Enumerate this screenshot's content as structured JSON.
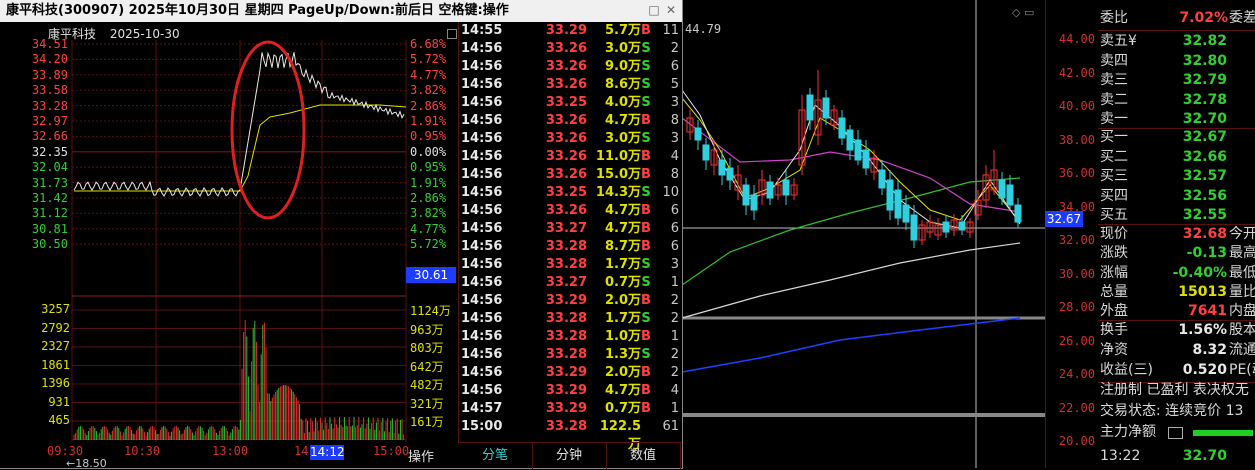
{
  "popup": {
    "title": "康平科技(300907) 2025年10月30日 星期四 PageUp/Down:前后日 空格键:操作",
    "chart_name": "康平科技",
    "chart_date": "2025-10-30",
    "left_axis": [
      "34.51",
      "34.20",
      "33.89",
      "33.58",
      "33.28",
      "32.97",
      "32.66",
      "32.35",
      "32.04",
      "31.73",
      "31.42",
      "31.12",
      "30.81",
      "30.50"
    ],
    "right_axis": [
      "6.68%",
      "5.72%",
      "4.77%",
      "3.82%",
      "2.86%",
      "1.91%",
      "0.95%",
      "0.00%",
      "0.95%",
      "1.91%",
      "2.86%",
      "3.82%",
      "4.77%",
      "5.72%"
    ],
    "vol_left_axis": [
      "3257",
      "2792",
      "2327",
      "1861",
      "1396",
      "931",
      "465"
    ],
    "vol_right_axis": [
      "1124万",
      "963万",
      "803万",
      "642万",
      "482万",
      "321万",
      "161万"
    ],
    "time_axis": [
      "09:30",
      "10:30",
      "13:00",
      "14",
      "15:00"
    ],
    "current_price_tag": "30.61",
    "current_time_tag": "14:12",
    "ops_label": "操作",
    "bottom_left_label": "←18.50"
  },
  "ticks": [
    {
      "time": "14:55",
      "price": "33.29",
      "vol": "5.7万",
      "dir": "B",
      "n": "11"
    },
    {
      "time": "14:56",
      "price": "33.26",
      "vol": "3.0万",
      "dir": "S",
      "n": "2"
    },
    {
      "time": "14:56",
      "price": "33.26",
      "vol": "9.0万",
      "dir": "S",
      "n": "6"
    },
    {
      "time": "14:56",
      "price": "33.26",
      "vol": "8.6万",
      "dir": "S",
      "n": "5"
    },
    {
      "time": "14:56",
      "price": "33.25",
      "vol": "4.0万",
      "dir": "S",
      "n": "3"
    },
    {
      "time": "14:56",
      "price": "33.26",
      "vol": "4.7万",
      "dir": "B",
      "n": "8"
    },
    {
      "time": "14:56",
      "price": "33.26",
      "vol": "3.0万",
      "dir": "S",
      "n": "3"
    },
    {
      "time": "14:56",
      "price": "33.26",
      "vol": "11.0万",
      "dir": "B",
      "n": "4"
    },
    {
      "time": "14:56",
      "price": "33.26",
      "vol": "15.0万",
      "dir": "B",
      "n": "8"
    },
    {
      "time": "14:56",
      "price": "33.25",
      "vol": "14.3万",
      "dir": "S",
      "n": "10"
    },
    {
      "time": "14:56",
      "price": "33.26",
      "vol": "4.7万",
      "dir": "B",
      "n": "6"
    },
    {
      "time": "14:56",
      "price": "33.27",
      "vol": "4.7万",
      "dir": "B",
      "n": "6"
    },
    {
      "time": "14:56",
      "price": "33.28",
      "vol": "8.7万",
      "dir": "B",
      "n": "6"
    },
    {
      "time": "14:56",
      "price": "33.28",
      "vol": "1.7万",
      "dir": "S",
      "n": "3"
    },
    {
      "time": "14:56",
      "price": "33.27",
      "vol": "0.7万",
      "dir": "S",
      "n": "1"
    },
    {
      "time": "14:56",
      "price": "33.29",
      "vol": "2.0万",
      "dir": "B",
      "n": "2"
    },
    {
      "time": "14:56",
      "price": "33.28",
      "vol": "1.7万",
      "dir": "S",
      "n": "2"
    },
    {
      "time": "14:56",
      "price": "33.28",
      "vol": "1.0万",
      "dir": "B",
      "n": "1"
    },
    {
      "time": "14:56",
      "price": "33.28",
      "vol": "1.3万",
      "dir": "S",
      "n": "2"
    },
    {
      "time": "14:56",
      "price": "33.29",
      "vol": "2.0万",
      "dir": "B",
      "n": "2"
    },
    {
      "time": "14:56",
      "price": "33.29",
      "vol": "4.7万",
      "dir": "B",
      "n": "4"
    },
    {
      "time": "14:57",
      "price": "33.29",
      "vol": "0.7万",
      "dir": "B",
      "n": "1"
    },
    {
      "time": "15:00",
      "price": "33.28",
      "vol": "122.5万",
      "dir": "",
      "n": "61"
    }
  ],
  "tick_tabs": [
    "分笔",
    "分钟",
    "数值"
  ],
  "bg": {
    "ma_label": "44.79",
    "axis": [
      "44.00",
      "42.00",
      "40.00",
      "38.00",
      "36.00",
      "34.00",
      "32.00",
      "30.00",
      "28.00",
      "26.00",
      "24.00",
      "22.00",
      "20.00"
    ],
    "price_tag": "32.67",
    "left_partial": "ℓ: 3"
  },
  "quote": {
    "wei_bi_label": "委比",
    "wei_bi_value": "7.02%",
    "wei_bi_extra": "委差",
    "asks": [
      {
        "label": "卖五",
        "value": "32.82",
        "mark": "¥"
      },
      {
        "label": "卖四",
        "value": "32.80",
        "mark": ""
      },
      {
        "label": "卖三",
        "value": "32.79",
        "mark": ""
      },
      {
        "label": "卖二",
        "value": "32.78",
        "mark": ""
      },
      {
        "label": "卖一",
        "value": "32.70",
        "mark": ""
      }
    ],
    "bids": [
      {
        "label": "买一",
        "value": "32.67"
      },
      {
        "label": "买二",
        "value": "32.66"
      },
      {
        "label": "买三",
        "value": "32.57"
      },
      {
        "label": "买四",
        "value": "32.56"
      },
      {
        "label": "买五",
        "value": "32.55"
      }
    ],
    "stats": [
      {
        "label": "现价",
        "value": "32.68",
        "extra": "今开",
        "color": "red"
      },
      {
        "label": "涨跌",
        "value": "-0.13",
        "extra": "最高",
        "color": "green"
      },
      {
        "label": "涨幅",
        "value": "-0.40%",
        "extra": "最低",
        "color": "green"
      },
      {
        "label": "总量",
        "value": "15013",
        "extra": "量比",
        "color": "yel"
      },
      {
        "label": "外盘",
        "value": "7641",
        "extra": "内盘",
        "color": "red"
      }
    ],
    "stats2": [
      {
        "label": "换手",
        "value": "1.56%",
        "extra": "股本"
      },
      {
        "label": "净资",
        "value": "8.32",
        "extra": "流通"
      },
      {
        "label": "收益(三)",
        "value": "0.520",
        "extra": "PE(动"
      }
    ],
    "reg_line": "注册制 已盈利 表决权无",
    "trade_status": "交易状态: 连续竞价 13",
    "main_flow_label": "主力净额",
    "last_time": "13:22",
    "last_price": "32.70"
  }
}
